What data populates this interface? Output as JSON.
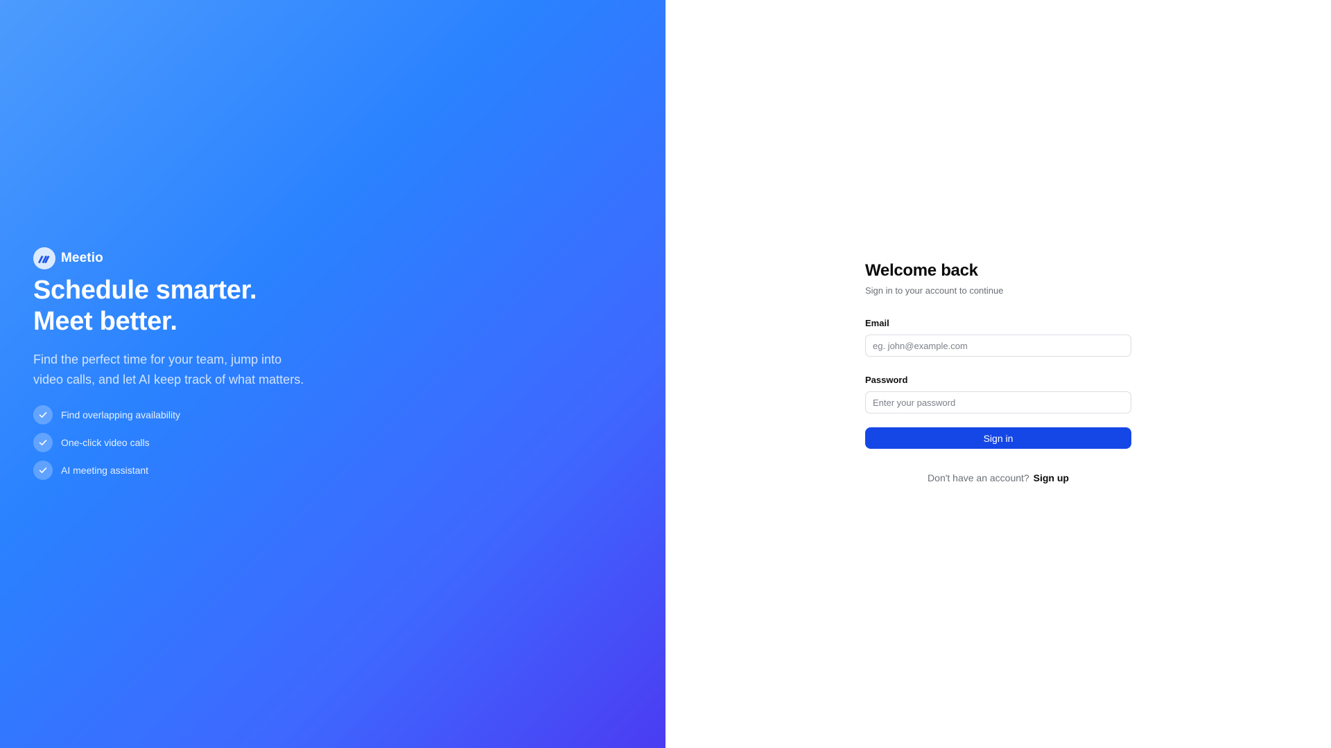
{
  "brand": {
    "name": "Meetio",
    "logo_icon": "meetio-logo-icon"
  },
  "hero": {
    "headline_line1": "Schedule smarter.",
    "headline_line2": "Meet better.",
    "description": "Find the perfect time for your team, jump into video calls, and let AI keep track of what matters.",
    "features": [
      {
        "label": "Find overlapping availability",
        "icon": "check-icon"
      },
      {
        "label": "One-click video calls",
        "icon": "check-icon"
      },
      {
        "label": "AI meeting assistant",
        "icon": "check-icon"
      }
    ]
  },
  "form": {
    "title": "Welcome back",
    "subtitle": "Sign in to your account to continue",
    "email": {
      "label": "Email",
      "placeholder": "eg. john@example.com",
      "value": ""
    },
    "password": {
      "label": "Password",
      "placeholder": "Enter your password",
      "value": ""
    },
    "submit_label": "Sign in",
    "signup_prompt": "Don't have an account?",
    "signup_link": "Sign up"
  },
  "colors": {
    "gradient_start": "#4c9bfd",
    "gradient_mid": "#2a82ff",
    "gradient_end": "#4b3cf2",
    "primary_button": "#1547e6",
    "text_primary": "#0b0b0b",
    "text_muted": "#6b6f76"
  }
}
